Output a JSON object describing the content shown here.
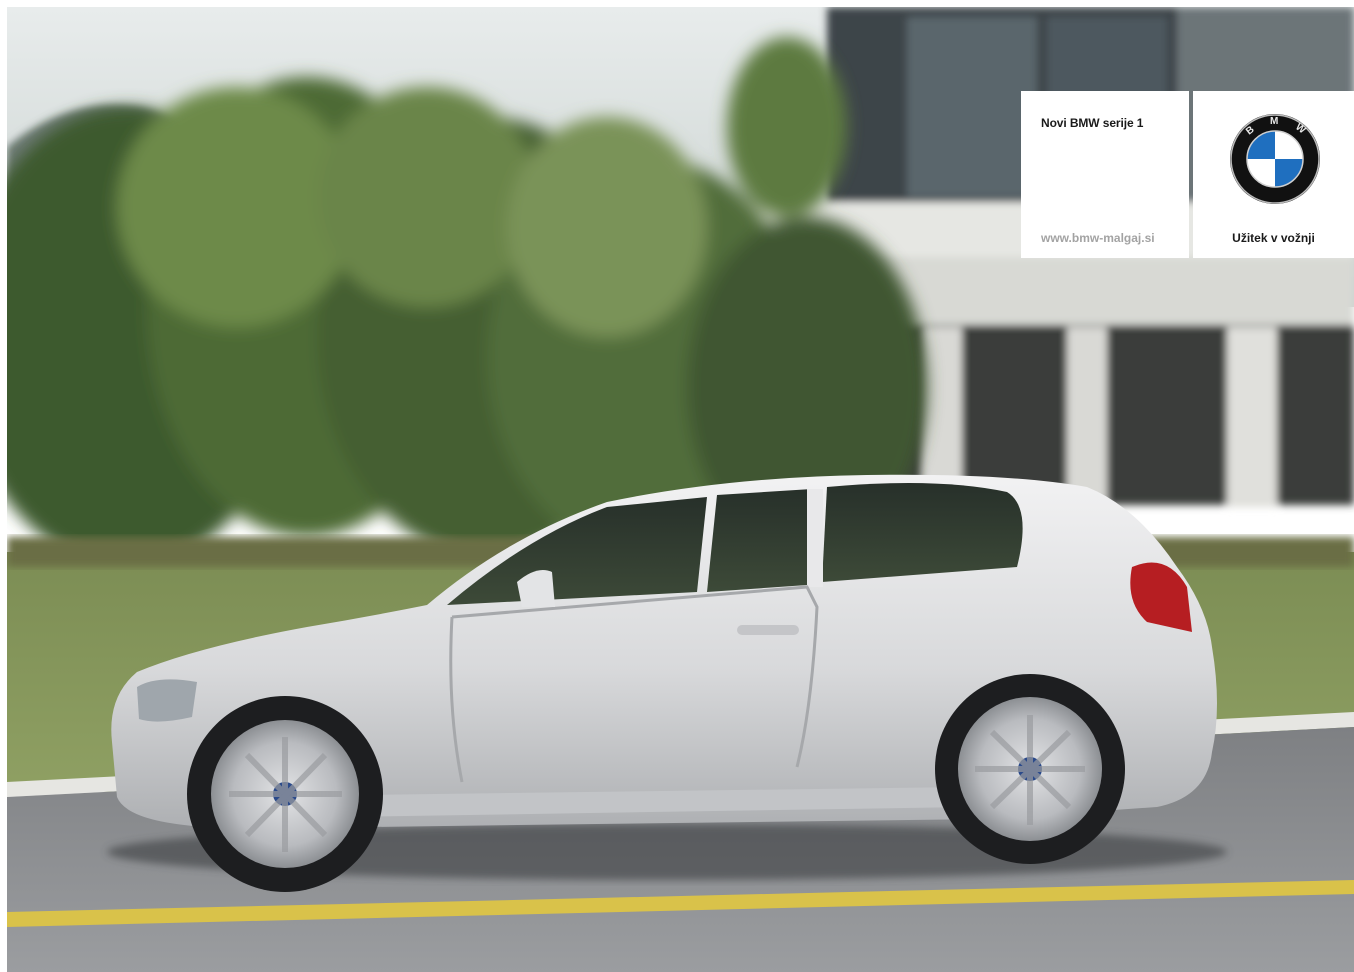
{
  "ad": {
    "model_title": "Novi BMW serije 1",
    "website": "www.bmw-malgaj.si",
    "tagline": "Užitek v vožnji",
    "logo_letters": "BMW"
  },
  "photo": {
    "subject": "car-side-view",
    "car_color": "#d9dadc"
  }
}
